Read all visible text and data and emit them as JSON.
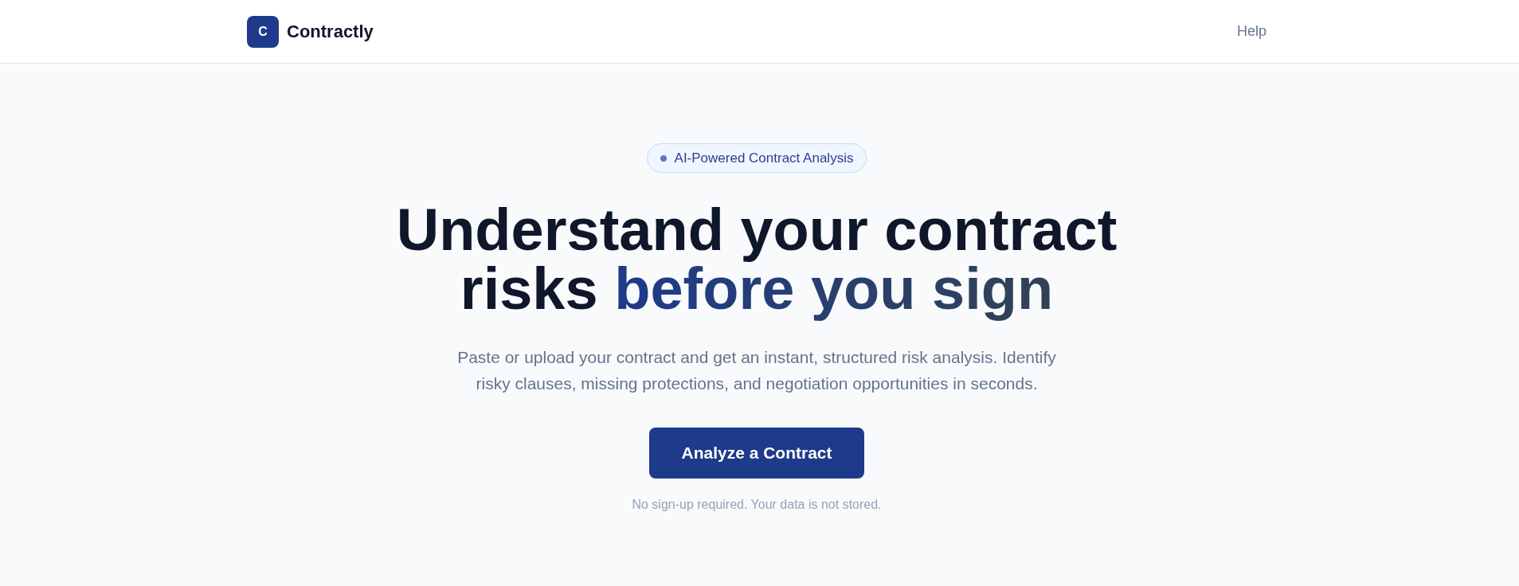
{
  "header": {
    "logo": {
      "letter": "C",
      "name": "Contractly"
    },
    "nav": [
      {
        "label": "Help"
      }
    ]
  },
  "hero": {
    "badge": "AI-Powered Contract Analysis",
    "headline": {
      "text": "Understand your contract risks",
      "highlight": "before you sign"
    },
    "description": "Paste or upload your contract and get an instant, structured risk analysis. Identify risky clauses, missing protections, and negotiation opportunities in seconds.",
    "cta": {
      "label": "Analyze a Contract"
    },
    "note": "No sign-up required. Your data is not stored."
  }
}
